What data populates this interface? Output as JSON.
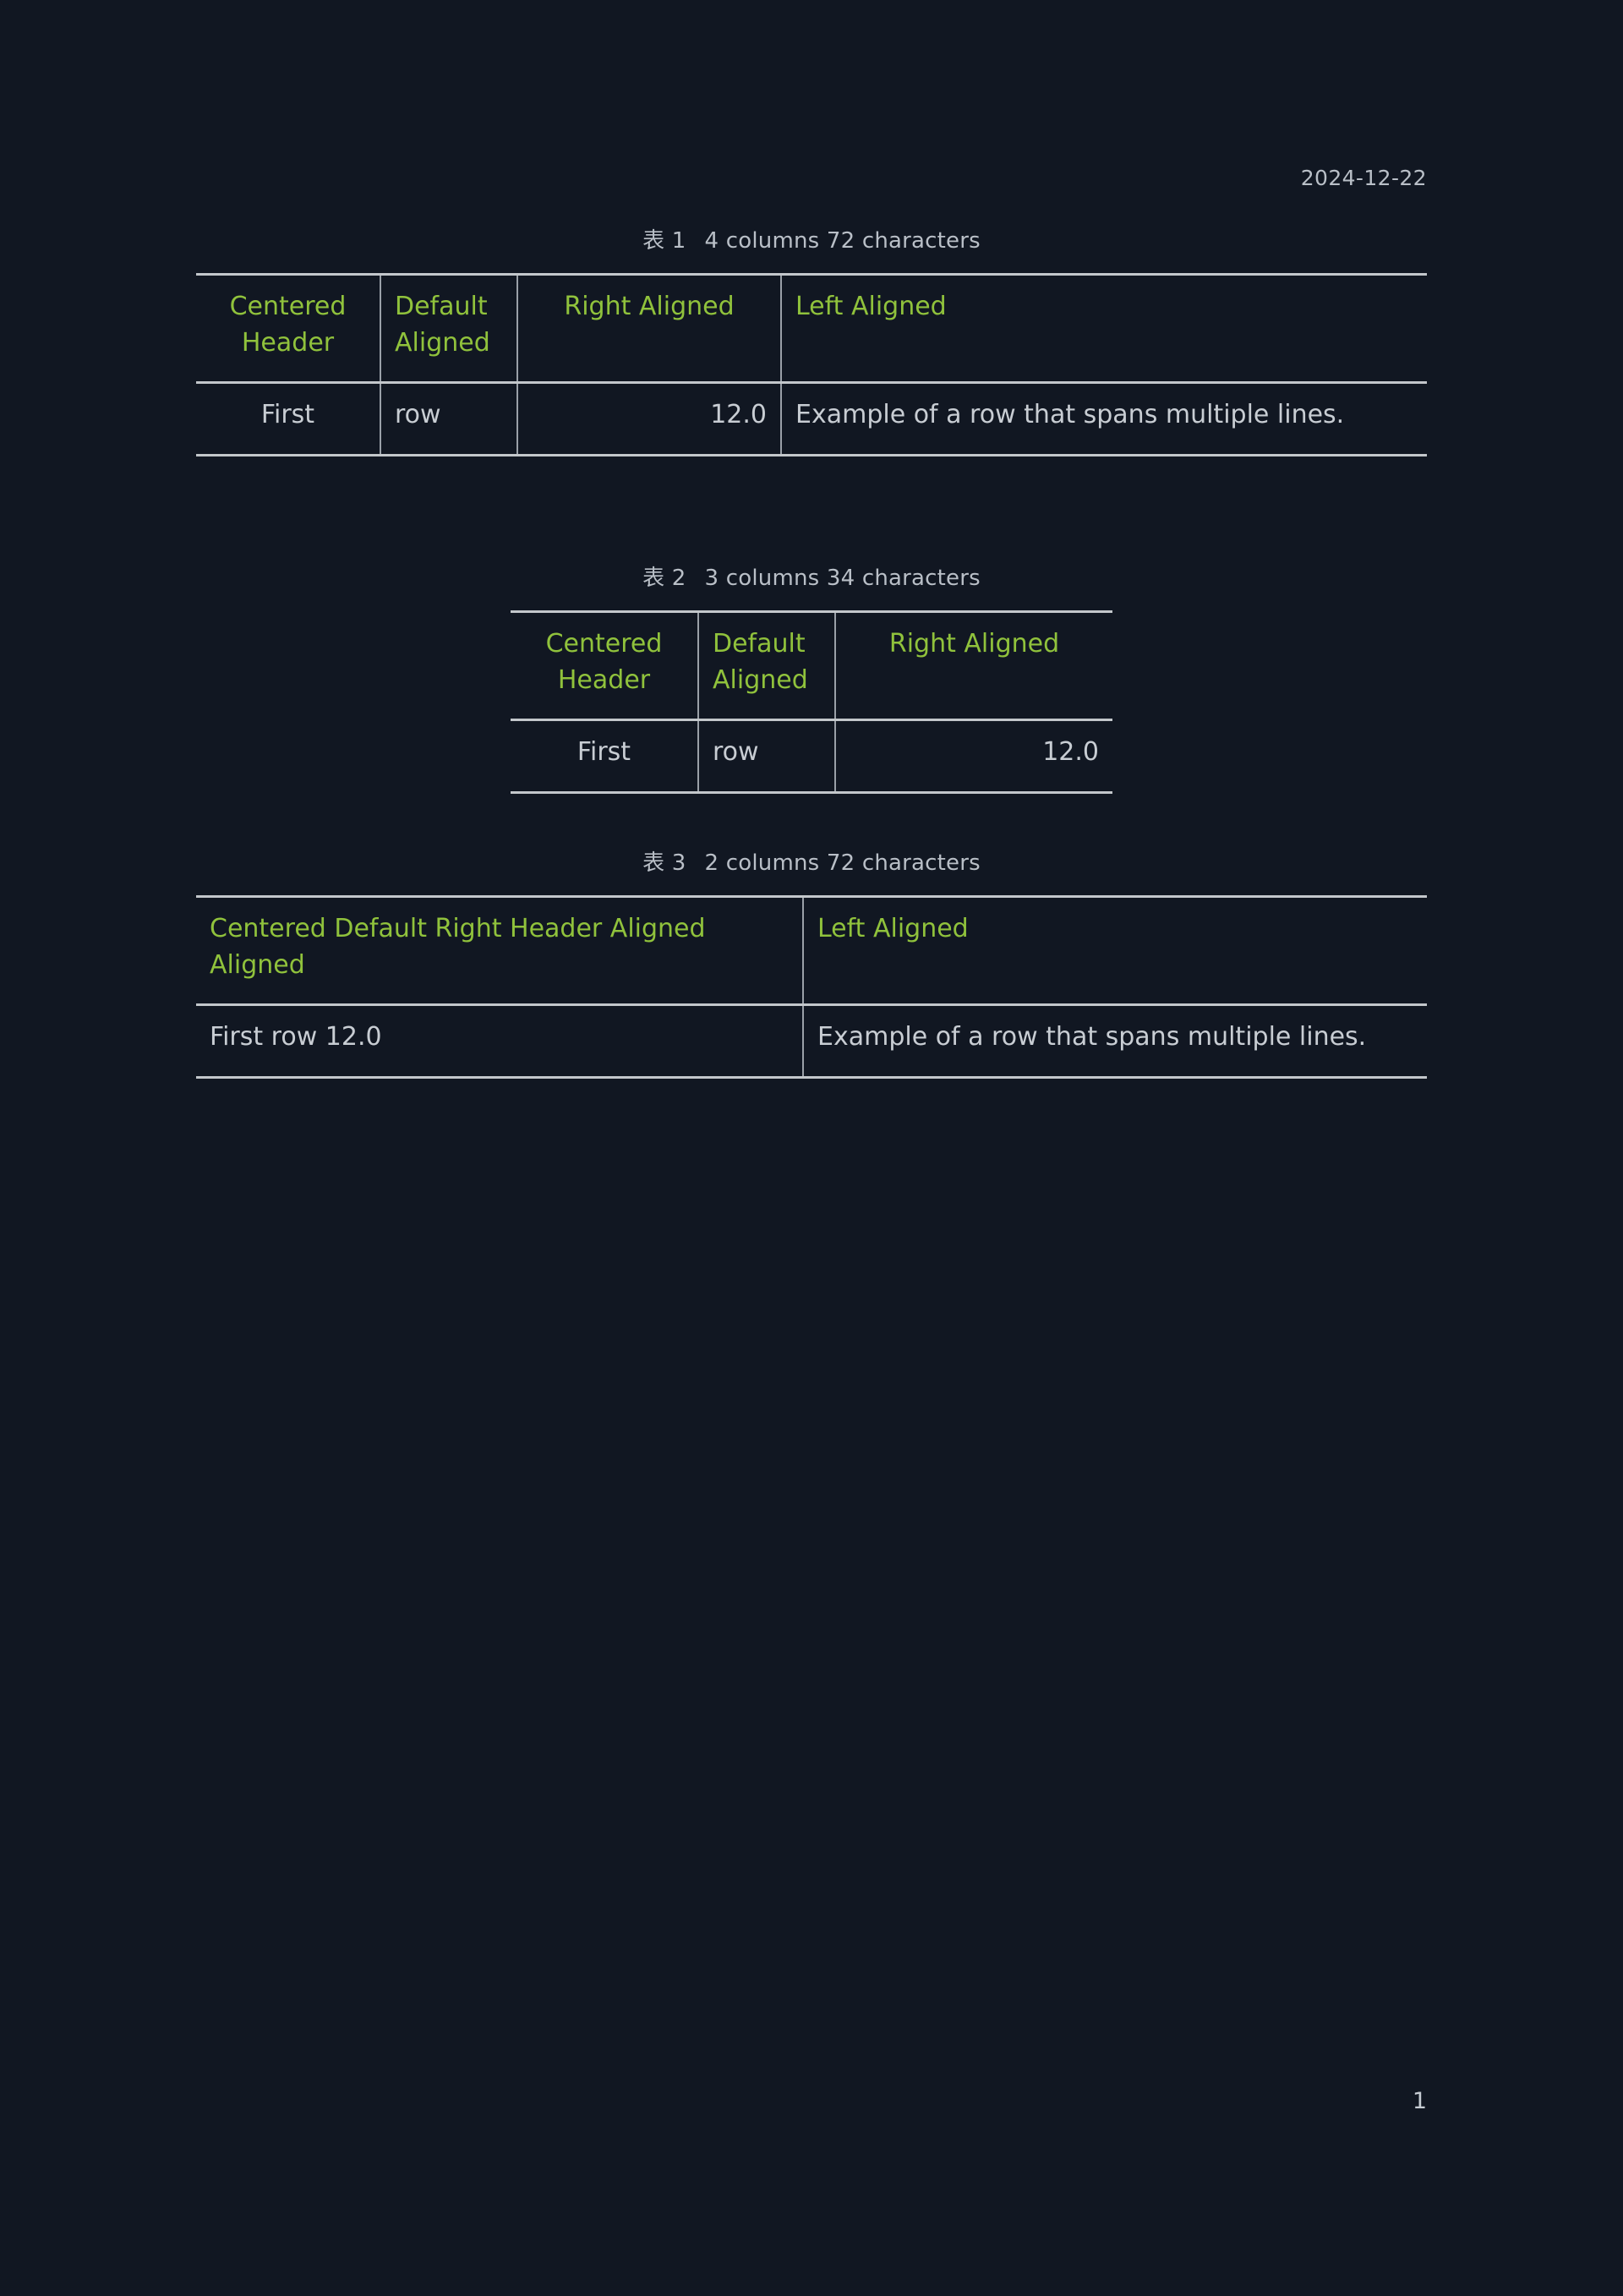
{
  "header": {
    "date": "2024-12-22"
  },
  "footer": {
    "page_number": "1"
  },
  "colors": {
    "background": "#111722",
    "header_text": "#90c23c",
    "body_text": "#c8cdd3",
    "rule": "#c3c7cb",
    "caption_text": "#b9bfc7"
  },
  "figures": [
    {
      "caption_label": "表 1",
      "caption_text": "4 columns 72 characters",
      "headers": [
        {
          "text": "Centered Header",
          "align": "center"
        },
        {
          "text": "Default Aligned",
          "align": "left"
        },
        {
          "text": "Right Aligned",
          "align": "center"
        },
        {
          "text": "Left Aligned",
          "align": "left"
        }
      ],
      "rows": [
        [
          {
            "text": "First",
            "align": "center"
          },
          {
            "text": "row",
            "align": "left"
          },
          {
            "text": "12.0",
            "align": "right"
          },
          {
            "text": "Example of a row that spans multiple lines.",
            "align": "left"
          }
        ]
      ]
    },
    {
      "caption_label": "表 2",
      "caption_text": "3 columns 34 characters",
      "headers": [
        {
          "text": "Centered Header",
          "align": "center"
        },
        {
          "text": "Default Aligned",
          "align": "left"
        },
        {
          "text": "Right Aligned",
          "align": "center"
        }
      ],
      "rows": [
        [
          {
            "text": "First",
            "align": "center"
          },
          {
            "text": "row",
            "align": "left"
          },
          {
            "text": "12.0",
            "align": "right"
          }
        ]
      ]
    },
    {
      "caption_label": "表 3",
      "caption_text": "2 columns 72 characters",
      "headers": [
        {
          "text": "Centered Default Right Header Aligned Aligned",
          "align": "left"
        },
        {
          "text": "Left Aligned",
          "align": "left"
        }
      ],
      "rows": [
        [
          {
            "text": "First row 12.0",
            "align": "left"
          },
          {
            "text": "Example of a row that spans multiple lines.",
            "align": "left"
          }
        ]
      ]
    }
  ]
}
